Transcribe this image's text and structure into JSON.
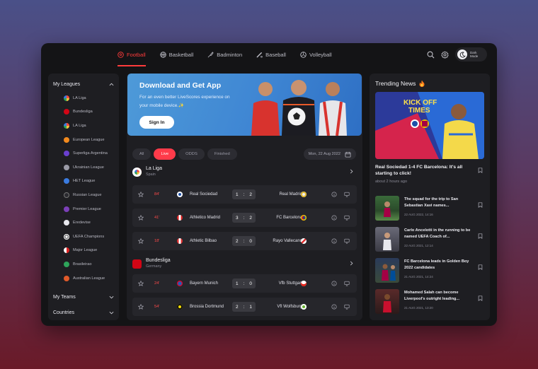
{
  "nav": {
    "tabs": [
      {
        "label": "Football",
        "icon": "football-icon"
      },
      {
        "label": "Basketball",
        "icon": "basketball-icon"
      },
      {
        "label": "Badminton",
        "icon": "shuttlecock-icon"
      },
      {
        "label": "Baseball",
        "icon": "baseball-bat-icon"
      },
      {
        "label": "Volleyball",
        "icon": "volleyball-icon"
      }
    ],
    "dark_mode_label": "Dark Mode"
  },
  "sidebar": {
    "my_leagues": "My Leagues",
    "leagues": [
      "LA Liga",
      "Bundesliga",
      "LA Liga",
      "European League",
      "Superliga Argentina",
      "Ukrainian League",
      "HET League",
      "Russian League",
      "Premier League",
      "Eredevise",
      "UEFA Champions",
      "Major League",
      "Brasileirao",
      "Australian League"
    ],
    "my_teams": "My Teams",
    "countries": "Countries"
  },
  "banner": {
    "title": "Download and Get App",
    "subtitle": "For an even better LiveScores experience on your mobile device.✨",
    "button": "Sign In"
  },
  "filters": {
    "items": [
      "All",
      "Live",
      "ODDS",
      "Finished"
    ],
    "active": "Live",
    "date": "Mon, 22 Aug 2022"
  },
  "leagues": [
    {
      "name": "La Liga",
      "country": "Spain",
      "matches": [
        {
          "minute": "84'",
          "home": "Real Sociedad",
          "home_score": "1",
          "away_score": "2",
          "away": "Real Madrid"
        },
        {
          "minute": "41'",
          "home": "Athletico Madrid",
          "home_score": "3",
          "away_score": "2",
          "away": "FC Barcelona"
        },
        {
          "minute": "18'",
          "home": "Athletic Bilbao",
          "home_score": "2",
          "away_score": "0",
          "away": "Rayo Vallecano"
        }
      ]
    },
    {
      "name": "Bundesliga",
      "country": "Germany",
      "matches": [
        {
          "minute": "24'",
          "home": "Bayern Munich",
          "home_score": "1",
          "away_score": "0",
          "away": "Vfb Stuttgart"
        },
        {
          "minute": "54'",
          "home": "Brossia Dortmund",
          "home_score": "2",
          "away_score": "1",
          "away": "Vfl Wolfsburg"
        }
      ]
    }
  ],
  "news": {
    "title": "Trending News",
    "hero_overlay": "KICK OFF TIMES",
    "featured": {
      "title": "Real Sociedad 1-4 FC Barcelona: It's all starting to click!",
      "time": "about 2 hours ago"
    },
    "items": [
      {
        "title": "The squad for the trip to San Sebastian Xavi names...",
        "date": "22 AUG 2022, 14:16"
      },
      {
        "title": "Carlo Ancelotti in the running to be named UEFA Coach of...",
        "date": "22 AUG 2021, 12:14"
      },
      {
        "title": "FC Barcelona leads in Golden Boy 2022 candidates",
        "date": "21 AUG 2021, 14:24"
      },
      {
        "title": "Mohamed Salah can become Liverpool's outright leading...",
        "date": "21 AUG 2021, 13:20"
      }
    ]
  },
  "colors": {
    "accent": "#ff3b3b",
    "panel": "#1e1e22",
    "row": "#26262b",
    "banner": "#3f86d3"
  }
}
